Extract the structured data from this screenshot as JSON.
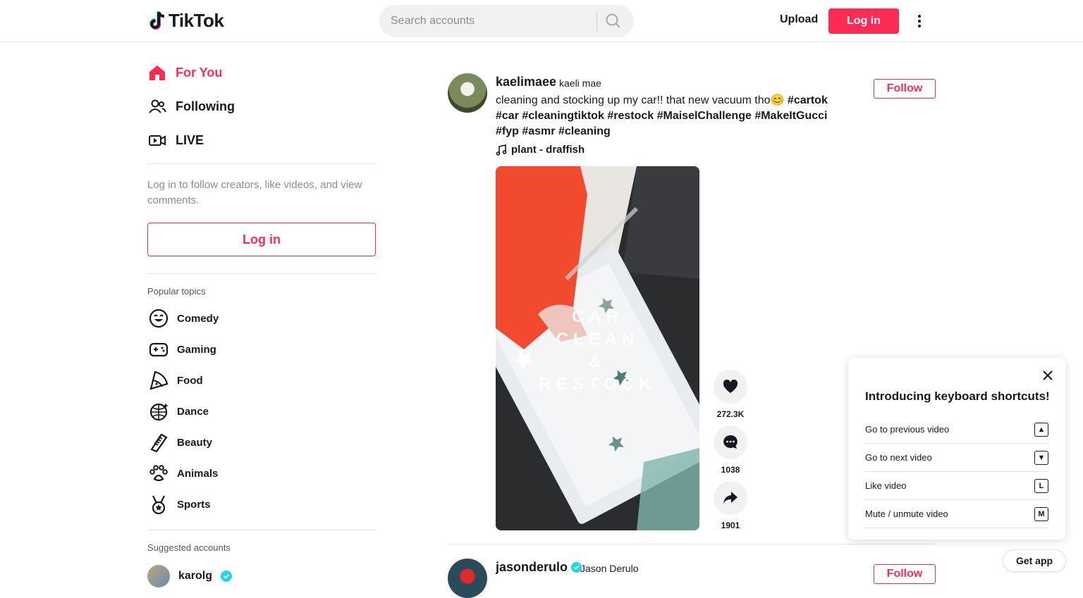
{
  "header": {
    "logo_text": "TikTok",
    "search_placeholder": "Search accounts",
    "upload_label": "Upload",
    "login_label": "Log in"
  },
  "sidebar": {
    "nav": [
      {
        "label": "For You",
        "icon": "home-icon",
        "active": true
      },
      {
        "label": "Following",
        "icon": "users-icon",
        "active": false
      },
      {
        "label": "LIVE",
        "icon": "live-icon",
        "active": false
      }
    ],
    "login_hint": "Log in to follow creators, like videos, and view comments.",
    "login_label": "Log in",
    "topics_title": "Popular topics",
    "topics": [
      "Comedy",
      "Gaming",
      "Food",
      "Dance",
      "Beauty",
      "Animals",
      "Sports"
    ],
    "suggested_title": "Suggested accounts",
    "suggested": [
      {
        "name": "karolg",
        "verified": true
      }
    ]
  },
  "feed": {
    "post1": {
      "username": "kaelimaee",
      "nickname": "kaeli mae",
      "caption_text": "cleaning and stocking up my car!! that new vacuum tho😊",
      "hashtags": [
        "#cartok",
        "#car",
        "#cleaningtiktok",
        "#restock",
        "#MaiselChallenge",
        "#MakeItGucci",
        "#fyp",
        "#asmr",
        "#cleaning"
      ],
      "music": "plant - draffish",
      "follow_label": "Follow",
      "video_overlay": [
        "CAR",
        "CLEAN",
        "&",
        "RESTOCK"
      ],
      "likes": "272.3K",
      "comments": "1038",
      "shares": "1901"
    },
    "post2": {
      "username": "jasonderulo",
      "nickname": "Jason Derulo",
      "verified": true,
      "follow_label": "Follow"
    }
  },
  "shortcuts": {
    "title": "Introducing keyboard shortcuts!",
    "items": [
      {
        "label": "Go to previous video",
        "key": "▲"
      },
      {
        "label": "Go to next video",
        "key": "▼"
      },
      {
        "label": "Like video",
        "key": "L"
      },
      {
        "label": "Mute / unmute video",
        "key": "M"
      }
    ]
  },
  "get_app_label": "Get app",
  "colors": {
    "accent": "#fe2c55",
    "verified": "#20d5ec"
  }
}
